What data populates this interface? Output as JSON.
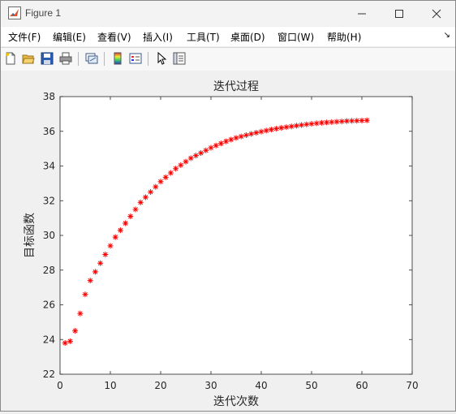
{
  "window": {
    "title": "Figure 1"
  },
  "menu": [
    "文件(F)",
    "编辑(E)",
    "查看(V)",
    "插入(I)",
    "工具(T)",
    "桌面(D)",
    "窗口(W)",
    "帮助(H)"
  ],
  "toolbar": [
    "new-figure-icon",
    "open-file-icon",
    "save-icon",
    "print-icon",
    "link-figure-icon",
    "colorbar-icon",
    "legend-icon",
    "pointer-icon",
    "property-inspector-icon"
  ],
  "colors": {
    "marker": "#ff0000",
    "axes": "#262626",
    "plot_bg": "#ffffff"
  },
  "chart_data": {
    "type": "scatter",
    "title": "迭代过程",
    "xlabel": "迭代次数",
    "ylabel": "目标函数",
    "xlim": [
      0,
      70
    ],
    "ylim": [
      22,
      38
    ],
    "xticks": [
      0,
      10,
      20,
      30,
      40,
      50,
      60,
      70
    ],
    "yticks": [
      22,
      24,
      26,
      28,
      30,
      32,
      34,
      36,
      38
    ],
    "marker": "*",
    "series": [
      {
        "x": [
          1,
          2,
          3,
          4,
          5,
          6,
          7,
          8,
          9,
          10,
          11,
          12,
          13,
          14,
          15,
          16,
          17,
          18,
          19,
          20,
          21,
          22,
          23,
          24,
          25,
          26,
          27,
          28,
          29,
          30,
          31,
          32,
          33,
          34,
          35,
          36,
          37,
          38,
          39,
          40,
          41,
          42,
          43,
          44,
          45,
          46,
          47,
          48,
          49,
          50,
          51,
          52,
          53,
          54,
          55,
          56,
          57,
          58,
          59,
          60,
          61
        ],
        "y": [
          23.8,
          23.9,
          24.5,
          25.5,
          26.6,
          27.4,
          27.9,
          28.4,
          28.9,
          29.4,
          29.9,
          30.3,
          30.7,
          31.1,
          31.5,
          31.9,
          32.2,
          32.5,
          32.8,
          33.1,
          33.35,
          33.6,
          33.85,
          34.05,
          34.25,
          34.45,
          34.6,
          34.75,
          34.9,
          35.05,
          35.18,
          35.3,
          35.42,
          35.52,
          35.62,
          35.7,
          35.78,
          35.85,
          35.92,
          35.98,
          36.04,
          36.1,
          36.15,
          36.2,
          36.24,
          36.28,
          36.32,
          36.36,
          36.4,
          36.43,
          36.46,
          36.49,
          36.51,
          36.53,
          36.55,
          36.57,
          36.59,
          36.6,
          36.61,
          36.62,
          36.63
        ]
      }
    ]
  }
}
